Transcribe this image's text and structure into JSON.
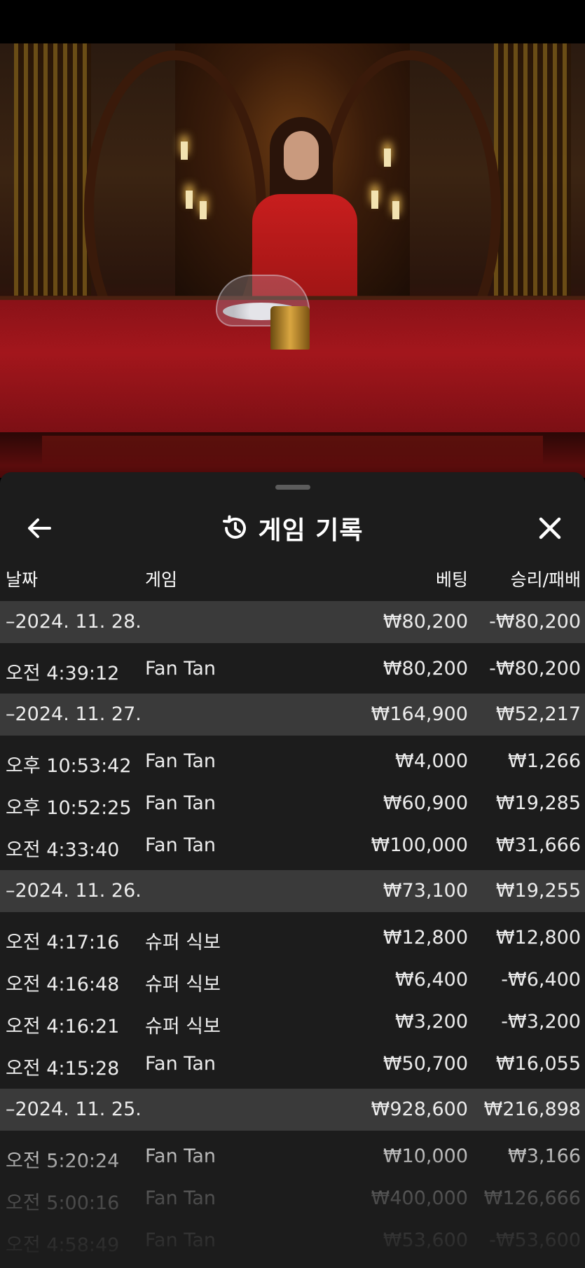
{
  "sheet": {
    "title": "게임 기록",
    "icons": {
      "back": "arrow-left-icon",
      "history": "history-icon",
      "close": "close-icon"
    }
  },
  "columns": {
    "date": "날짜",
    "game": "게임",
    "bet": "베팅",
    "win_loss": "승리/패배"
  },
  "groups": [
    {
      "date": "–2024. 11. 28.",
      "bet_total": "₩80,200",
      "win_total": "-₩80,200",
      "rows": [
        {
          "time": "오전 4:39:12",
          "game": "Fan Tan",
          "bet": "₩80,200",
          "win": "-₩80,200"
        }
      ]
    },
    {
      "date": "–2024. 11. 27.",
      "bet_total": "₩164,900",
      "win_total": "₩52,217",
      "rows": [
        {
          "time": "오후 10:53:42",
          "game": "Fan Tan",
          "bet": "₩4,000",
          "win": "₩1,266"
        },
        {
          "time": "오후 10:52:25",
          "game": "Fan Tan",
          "bet": "₩60,900",
          "win": "₩19,285"
        },
        {
          "time": "오전 4:33:40",
          "game": "Fan Tan",
          "bet": "₩100,000",
          "win": "₩31,666"
        }
      ]
    },
    {
      "date": "–2024. 11. 26.",
      "bet_total": "₩73,100",
      "win_total": "₩19,255",
      "rows": [
        {
          "time": "오전 4:17:16",
          "game": "슈퍼 식보",
          "bet": "₩12,800",
          "win": "₩12,800"
        },
        {
          "time": "오전 4:16:48",
          "game": "슈퍼 식보",
          "bet": "₩6,400",
          "win": "-₩6,400"
        },
        {
          "time": "오전 4:16:21",
          "game": "슈퍼 식보",
          "bet": "₩3,200",
          "win": "-₩3,200"
        },
        {
          "time": "오전 4:15:28",
          "game": "Fan Tan",
          "bet": "₩50,700",
          "win": "₩16,055"
        }
      ]
    },
    {
      "date": "–2024. 11. 25.",
      "bet_total": "₩928,600",
      "win_total": "₩216,898",
      "rows": [
        {
          "time": "오전 5:20:24",
          "game": "Fan Tan",
          "bet": "₩10,000",
          "win": "₩3,166"
        },
        {
          "time": "오전 5:00:16",
          "game": "Fan Tan",
          "bet": "₩400,000",
          "win": "₩126,666"
        },
        {
          "time": "오전 4:58:49",
          "game": "Fan Tan",
          "bet": "₩53,600",
          "win": "-₩53,600"
        }
      ]
    }
  ]
}
